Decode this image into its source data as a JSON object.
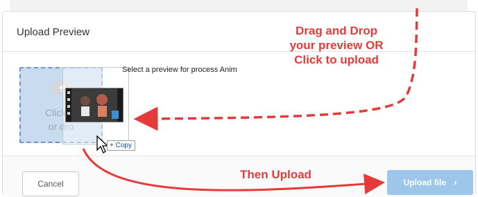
{
  "dialog": {
    "title": "Upload Preview",
    "prompt": "Select a preview for process Anim",
    "dropzone_text": "Click to\nor dro",
    "drag_badge": "+ Copy",
    "cancel_label": "Cancel",
    "upload_label": "Upload file",
    "upload_chevron": "›"
  },
  "annotations": {
    "drag_hint_line1": "Drag and Drop",
    "drag_hint_line2": "your preview OR",
    "drag_hint_line3": "Click to upload",
    "upload_hint": "Then Upload"
  },
  "colors": {
    "annotation_red": "#e53a3a",
    "upload_button": "#9ec6ea",
    "dropzone_fill": "#c9dcef",
    "dropzone_border": "#6f93c5"
  },
  "icons": {
    "dropzone_icon": "cloud-upload-icon",
    "drag_cursor": "pointer-cursor-icon",
    "upload_chevron": "chevron-right-icon"
  }
}
